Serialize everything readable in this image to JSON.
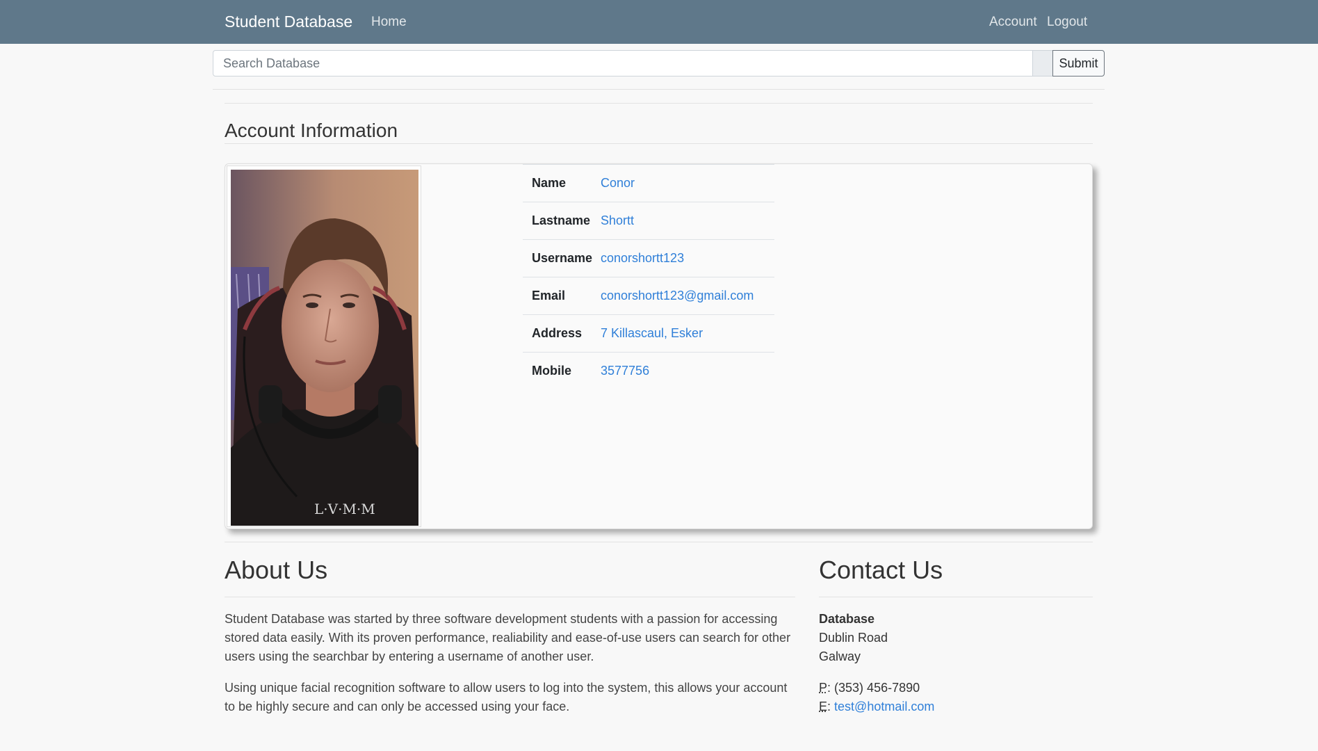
{
  "navbar": {
    "brand": "Student Database",
    "home": "Home",
    "account": "Account",
    "logout": "Logout"
  },
  "search": {
    "placeholder": "Search Database",
    "submit_label": "Submit"
  },
  "account": {
    "title": "Account Information",
    "fields": [
      {
        "label": "Name",
        "value": "Conor"
      },
      {
        "label": "Lastname",
        "value": "Shortt"
      },
      {
        "label": "Username",
        "value": "conorshortt123"
      },
      {
        "label": "Email",
        "value": "conorshortt123@gmail.com"
      },
      {
        "label": "Address",
        "value": "7 Killascaul, Esker"
      },
      {
        "label": "Mobile",
        "value": "3577756"
      }
    ],
    "photo_shirt_text": "L·V·M·M"
  },
  "about": {
    "title": "About Us",
    "paragraph1": "Student Database was started by three software development students with a passion for accessing stored data easily. With its proven performance, realiability and ease-of-use users can search for other users using the searchbar by entering a username of another user.",
    "paragraph2": "Using unique facial recognition software to allow users to log into the system, this allows your account to be highly secure and can only be accessed using your face."
  },
  "contact": {
    "title": "Contact Us",
    "org": "Database",
    "address_line1": "Dublin Road",
    "address_line2": "Galway",
    "phone_abbr": "P",
    "phone": "(353) 456-7890",
    "email_abbr": "E",
    "email": "test@hotmail.com"
  },
  "colors": {
    "navbar_bg": "#5f788a",
    "link": "#2f7fd8",
    "page_bg": "#f8f8f8"
  }
}
